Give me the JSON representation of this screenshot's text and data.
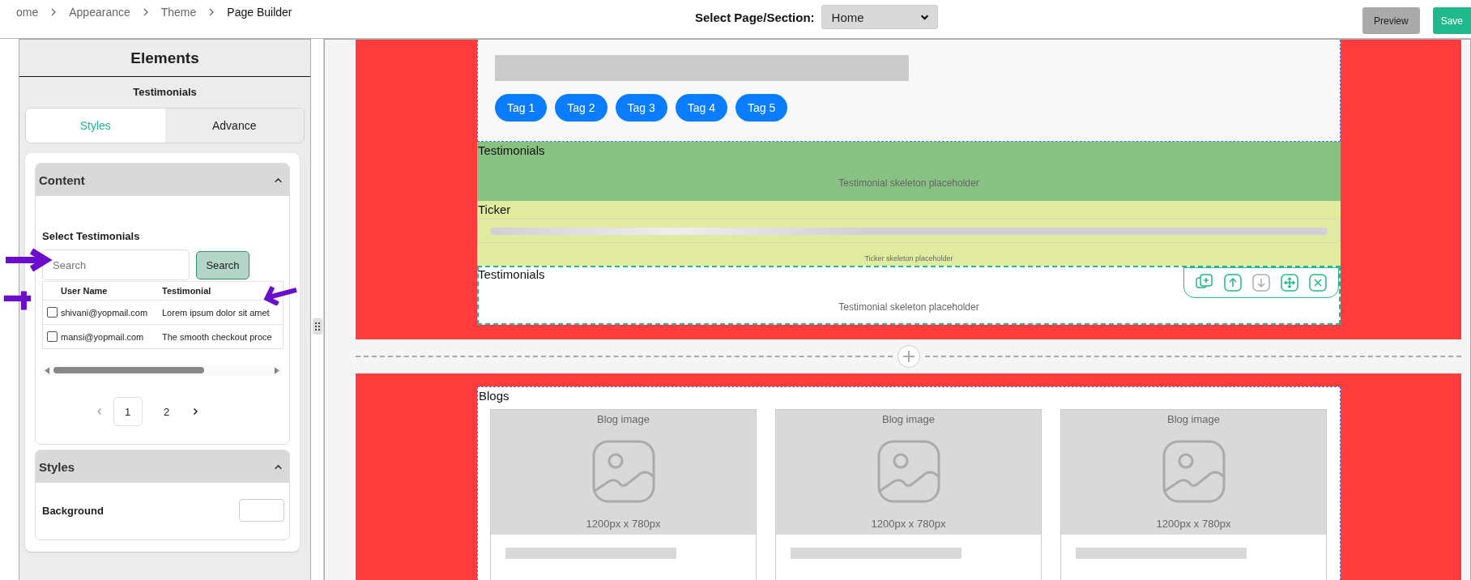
{
  "breadcrumb": [
    {
      "label": "ome",
      "current": false
    },
    {
      "label": "Appearance",
      "current": false
    },
    {
      "label": "Theme",
      "current": false
    },
    {
      "label": "Page Builder",
      "current": true
    }
  ],
  "page_select": {
    "label": "Select Page/Section:",
    "value": "Home"
  },
  "header_buttons": [
    {
      "label": "Preview",
      "kind": "secondary"
    },
    {
      "label": "Save",
      "kind": "primary"
    }
  ],
  "sidebar": {
    "title": "Elements",
    "subtitle": "Testimonials",
    "tabs": [
      {
        "label": "Styles",
        "selected": true
      },
      {
        "label": "Advance",
        "selected": false
      }
    ],
    "content_panel": {
      "title": "Content",
      "expanded": true,
      "field_label": "Select Testimonials",
      "search": {
        "placeholder": "Search",
        "button": "Search"
      },
      "table": {
        "columns": [
          "User Name",
          "Testimonial"
        ],
        "rows": [
          {
            "checked": false,
            "cells": [
              "shivani@yopmail.com",
              "Lorem ipsum dolor sit amet"
            ]
          },
          {
            "checked": false,
            "cells": [
              "mansi@yopmail.com",
              "The smooth checkout proce"
            ]
          }
        ]
      },
      "pagination": [
        {
          "label": "1",
          "selected": true
        },
        {
          "label": "2",
          "selected": false
        }
      ]
    },
    "styles_panel": {
      "title": "Styles",
      "expanded": true,
      "field_label": "Background"
    }
  },
  "canvas": {
    "sections": [
      {
        "blocks": [
          {
            "kind": "tags",
            "selected": false,
            "tags": [
              "Tag 1",
              "Tag 2",
              "Tag 3",
              "Tag 4",
              "Tag 5"
            ]
          },
          {
            "kind": "testimonials",
            "selected": false,
            "color": "#88c282",
            "title": "Testimonials",
            "placeholder_text": "Testimonial skeleton placeholder"
          },
          {
            "kind": "ticker",
            "selected": false,
            "color": "#e1eb9f",
            "title": "Ticker",
            "placeholder_text": "Ticker skeleton placeholder"
          },
          {
            "kind": "testimonials",
            "selected": true,
            "color": "#ffffff",
            "title": "Testimonials",
            "placeholder_text": "Testimonial skeleton placeholder"
          }
        ]
      },
      {
        "blocks": [
          {
            "kind": "blogs",
            "selected": false,
            "title": "Blogs",
            "cards": [
              {
                "image_label": "Blog image",
                "size": "1200px x 780px"
              },
              {
                "image_label": "Blog image",
                "size": "1200px x 780px"
              },
              {
                "image_label": "Blog image",
                "size": "1200px x 780px"
              }
            ]
          }
        ]
      }
    ],
    "toolbar": [
      {
        "kind": "duplicate",
        "disabled": false
      },
      {
        "kind": "up",
        "disabled": false
      },
      {
        "kind": "down",
        "disabled": true
      },
      {
        "kind": "move",
        "disabled": false
      },
      {
        "kind": "delete",
        "disabled": false
      }
    ]
  }
}
